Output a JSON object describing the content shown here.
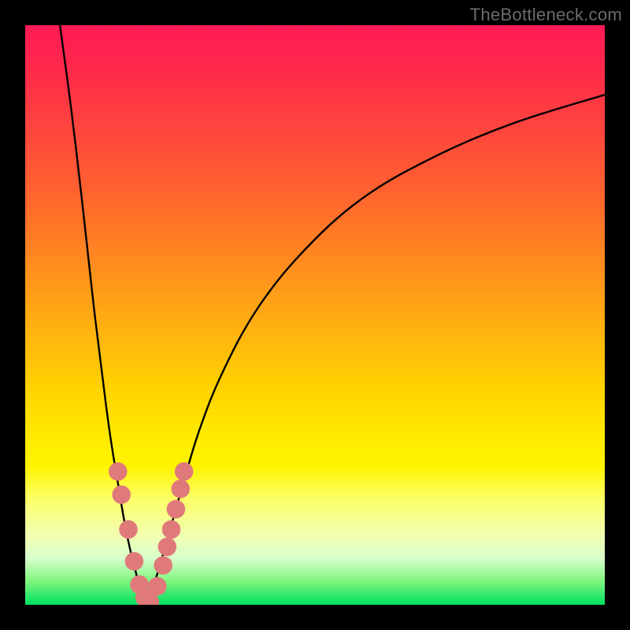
{
  "watermark": "TheBottleneck.com",
  "chart_data": {
    "type": "line",
    "title": "",
    "xlabel": "",
    "ylabel": "",
    "xlim": [
      0,
      100
    ],
    "ylim": [
      0,
      100
    ],
    "grid": false,
    "legend": false,
    "optimal_x": 21,
    "series": [
      {
        "name": "left-branch",
        "x": [
          6,
          8,
          10,
          12,
          14,
          15,
          16,
          17,
          18,
          19,
          20,
          21
        ],
        "y": [
          100,
          85,
          68,
          50,
          34,
          27,
          21,
          15,
          10,
          6,
          2,
          0
        ]
      },
      {
        "name": "right-branch",
        "x": [
          21,
          23,
          25,
          27,
          30,
          34,
          40,
          48,
          58,
          70,
          84,
          100
        ],
        "y": [
          0,
          6,
          13,
          20,
          30,
          40,
          51,
          61,
          70,
          77,
          83,
          88
        ]
      }
    ],
    "markers": {
      "name": "highlight-dots",
      "color": "#e07a7a",
      "radius_units": 1.6,
      "points": [
        {
          "x": 16.0,
          "y": 23.0
        },
        {
          "x": 16.6,
          "y": 19.0
        },
        {
          "x": 17.8,
          "y": 13.0
        },
        {
          "x": 18.8,
          "y": 7.5
        },
        {
          "x": 19.7,
          "y": 3.5
        },
        {
          "x": 20.6,
          "y": 1.2
        },
        {
          "x": 21.5,
          "y": 0.5
        },
        {
          "x": 22.8,
          "y": 3.2
        },
        {
          "x": 23.8,
          "y": 6.8
        },
        {
          "x": 24.5,
          "y": 10.0
        },
        {
          "x": 25.2,
          "y": 13.0
        },
        {
          "x": 26.0,
          "y": 16.5
        },
        {
          "x": 26.8,
          "y": 20.0
        },
        {
          "x": 27.4,
          "y": 23.0
        }
      ]
    }
  }
}
